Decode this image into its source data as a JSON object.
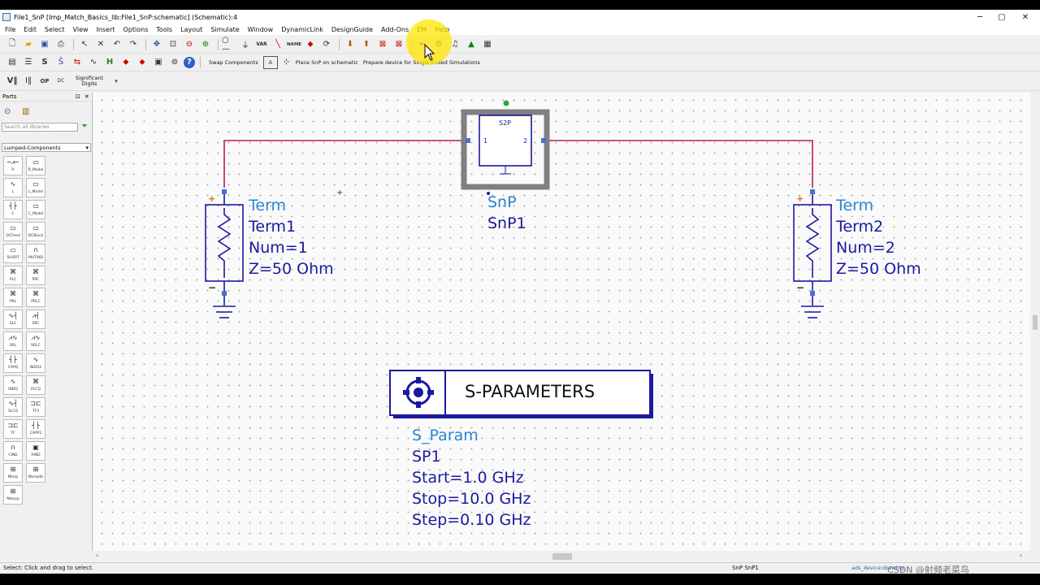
{
  "window": {
    "title": "File1_SnP [Imp_Match_Basics_lib:File1_SnP:schematic] (Schematic):4"
  },
  "menu": [
    "File",
    "Edit",
    "Select",
    "View",
    "Insert",
    "Options",
    "Tools",
    "Layout",
    "Simulate",
    "Window",
    "DynamicLink",
    "DesignGuide",
    "Add-Ons",
    "EM",
    "Help"
  ],
  "toolbar": {
    "swap_components": "Swap Components",
    "place_snp": "Place SnP on schematic",
    "prepare_device": "Prepare device for Single Ended Simulations",
    "significant_digits": "Significant Digits",
    "var_label": "VAR",
    "name_label": "NAME"
  },
  "parts_panel": {
    "title": "Parts",
    "search_placeholder": "Search all libraries",
    "library": "Lumped-Components",
    "items": [
      "R",
      "R_Model",
      "L",
      "L_Model",
      "C",
      "C_Model",
      "DCFeed",
      "DCBlock",
      "SHORT",
      "MUTIND",
      "PLC",
      "PRC",
      "PRL",
      "PRLC",
      "SLC",
      "SRC",
      "SRL",
      "SRLC",
      "CAPQ",
      "INDQ2",
      "INDQ",
      "PLCQ",
      "SLCQ",
      "TF3",
      "TF",
      "CAPP2",
      "CIND",
      "RIND",
      "Nterp",
      "Nterpdb",
      "Nterpp"
    ]
  },
  "schematic": {
    "snp": {
      "box_label": "S2P",
      "port1": "1",
      "port2": "2",
      "type": "SnP",
      "name": "SnP1"
    },
    "term1": {
      "type": "Term",
      "name": "Term1",
      "num": "Num=1",
      "z": "Z=50 Ohm"
    },
    "term2": {
      "type": "Term",
      "name": "Term2",
      "num": "Num=2",
      "z": "Z=50 Ohm"
    },
    "sparam": {
      "title": "S-PARAMETERS",
      "type": "S_Param",
      "name": "SP1",
      "start": "Start=1.0 GHz",
      "stop": "Stop=10.0 GHz",
      "step": "Step=0.10 GHz"
    },
    "plus": "+",
    "minus": "−"
  },
  "status": {
    "left": "Select: Click and drag to select.",
    "selection": "SnP SnP1",
    "right": "ads_device:drawing",
    "watermark": "CSDN @射频老菜鸟"
  },
  "colors": {
    "wire": "#c2185b",
    "component": "#1a1aa0",
    "label": "#2a85d0",
    "highlight": "#ffe600"
  }
}
